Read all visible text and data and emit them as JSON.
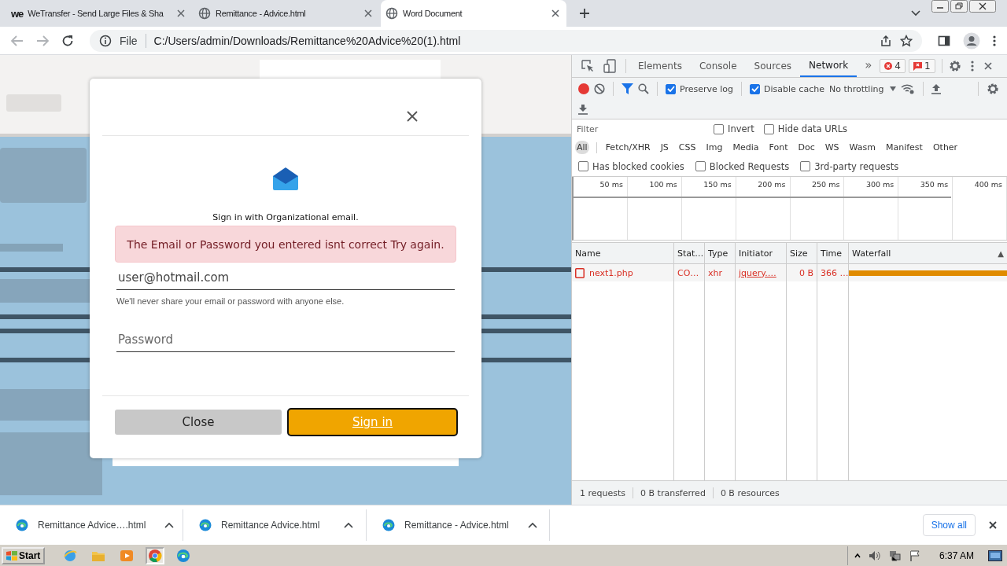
{
  "browser": {
    "tabs": [
      {
        "title": "WeTransfer - Send Large Files & Sha",
        "selected": false,
        "kind": "brand",
        "logo": "we"
      },
      {
        "title": "Remittance - Advice.html",
        "selected": false,
        "kind": "page"
      },
      {
        "title": "Word Document",
        "selected": true,
        "kind": "page"
      }
    ],
    "address": {
      "scheme": "File",
      "url": "C:/Users/admin/Downloads/Remittance%20Advice%20(1).html"
    }
  },
  "modal": {
    "heading": "Sign in with Organizational email.",
    "alert": "The Email or Password you entered isnt correct Try again.",
    "email": {
      "value": "user@hotmail.com"
    },
    "help": "We'll never share your email or password with anyone else.",
    "password": {
      "placeholder": "Password"
    },
    "buttons": [
      {
        "label": "Close",
        "kind": "secondary"
      },
      {
        "label": "Sign in",
        "kind": "primary"
      }
    ]
  },
  "devtools": {
    "tabs": [
      {
        "label": "Elements",
        "selected": false
      },
      {
        "label": "Console",
        "selected": false
      },
      {
        "label": "Sources",
        "selected": false
      },
      {
        "label": "Network",
        "selected": true
      }
    ],
    "more": "»",
    "errors": "4",
    "warnings": "1",
    "toolbar": [
      {
        "label": "Preserve log",
        "checked": true
      },
      {
        "label": "Disable cache",
        "checked": true
      }
    ],
    "throttling": "No throttling",
    "filter": {
      "placeholder": "Filter"
    },
    "filter_options": [
      {
        "label": "Invert",
        "checked": false
      },
      {
        "label": "Hide data URLs",
        "checked": false
      }
    ],
    "types": [
      {
        "label": "All",
        "selected": true
      },
      {
        "label": "Fetch/XHR",
        "selected": false
      },
      {
        "label": "JS",
        "selected": false
      },
      {
        "label": "CSS",
        "selected": false
      },
      {
        "label": "Img",
        "selected": false
      },
      {
        "label": "Media",
        "selected": false
      },
      {
        "label": "Font",
        "selected": false
      },
      {
        "label": "Doc",
        "selected": false
      },
      {
        "label": "WS",
        "selected": false
      },
      {
        "label": "Wasm",
        "selected": false
      },
      {
        "label": "Manifest",
        "selected": false
      },
      {
        "label": "Other",
        "selected": false
      }
    ],
    "request_filters": [
      {
        "label": "Has blocked cookies",
        "checked": false
      },
      {
        "label": "Blocked Requests",
        "checked": false
      },
      {
        "label": "3rd-party requests",
        "checked": false
      }
    ],
    "timeline_ticks": [
      "50 ms",
      "100 ms",
      "150 ms",
      "200 ms",
      "250 ms",
      "300 ms",
      "350 ms",
      "400 ms"
    ],
    "table": {
      "columns": [
        "Name",
        "Stat…",
        "Type",
        "Initiator",
        "Size",
        "Time",
        "Waterfall"
      ],
      "sort_mark": "▲",
      "rows": [
        {
          "failed": true,
          "cells": [
            "next1.php",
            "CO…",
            "xhr",
            "jquery.…",
            "0 B",
            "366 …"
          ]
        }
      ]
    },
    "summary": [
      "1 requests",
      "0 B transferred",
      "0 B resources"
    ]
  },
  "downloads": {
    "items": [
      {
        "name": "Remittance Advice….html"
      },
      {
        "name": "Remittance Advice.html"
      },
      {
        "name": "Remittance - Advice.html"
      }
    ],
    "show_all": "Show all"
  },
  "taskbar": {
    "start": "Start",
    "clock": "6:37 AM"
  }
}
